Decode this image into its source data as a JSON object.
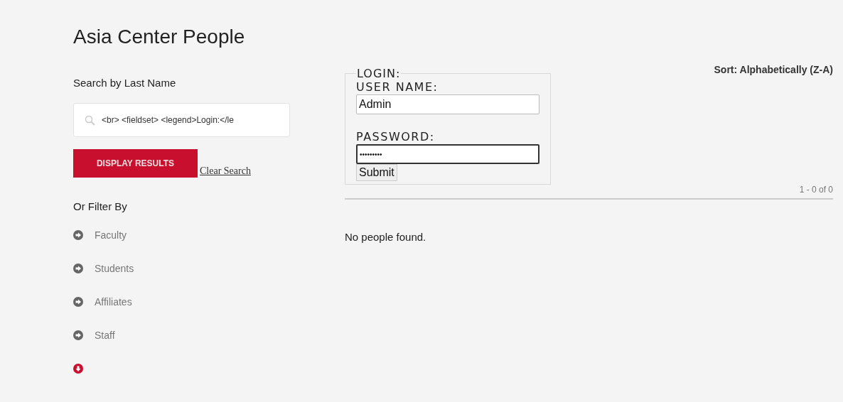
{
  "page_title": "Asia Center People",
  "sort": "Sort: Alphabetically (Z-A)",
  "search": {
    "label": "Search by Last Name",
    "value": "<br> <fieldset> <legend>Login:</le"
  },
  "display_button": "DISPLAY RESULTS",
  "clear_link": "Clear Search",
  "filter_heading": "Or Filter By",
  "filters": [
    {
      "label": "Faculty",
      "expanded": false
    },
    {
      "label": "Students",
      "expanded": false
    },
    {
      "label": "Affiliates",
      "expanded": false
    },
    {
      "label": "Staff",
      "expanded": false
    },
    {
      "expanded": true
    }
  ],
  "login": {
    "legend": "LOGIN:",
    "username_label": "USER NAME:",
    "username": "Admin",
    "password_label": "PASSWORD:",
    "password": "•••••••••",
    "submit": "Submit"
  },
  "pagination": "1 - 0 of 0",
  "empty_message": "No people found."
}
